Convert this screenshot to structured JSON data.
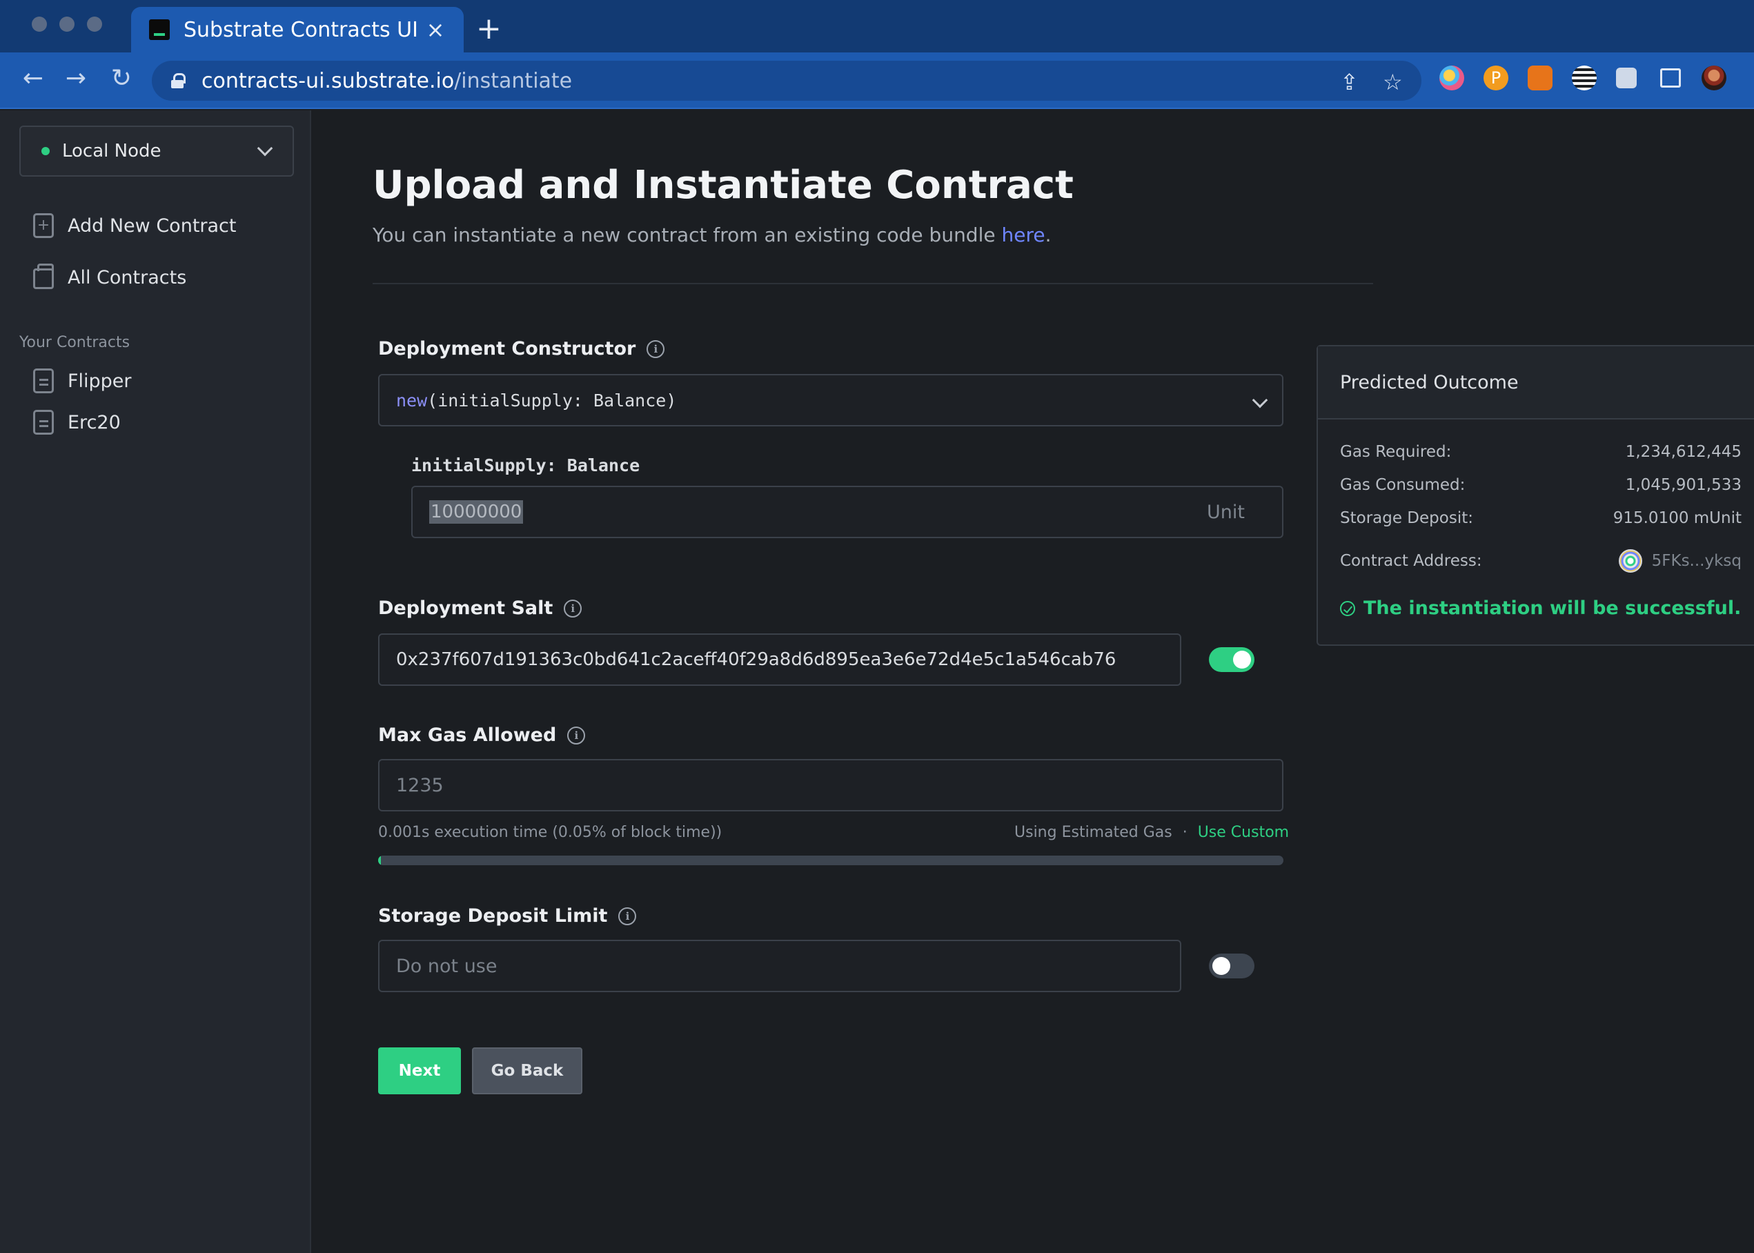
{
  "browser": {
    "tab_title": "Substrate Contracts UI",
    "tab_close": "×",
    "new_tab": "+",
    "url_host": "contracts-ui.substrate.io",
    "url_path": "/instantiate",
    "extensions": [
      "rainbow-ext-icon",
      "polkadot-ext-icon",
      "metamask-ext-icon",
      "talisman-ext-icon",
      "puzzle-icon",
      "sidepanel-icon",
      "profile-avatar"
    ]
  },
  "sidebar": {
    "node_label": "Local Node",
    "items": [
      {
        "label": "Add New Contract",
        "icon": "add-file-icon"
      },
      {
        "label": "All Contracts",
        "icon": "stack-icon"
      }
    ],
    "section_title": "Your Contracts",
    "contracts": [
      {
        "label": "Flipper",
        "icon": "document-icon"
      },
      {
        "label": "Erc20",
        "icon": "document-icon"
      }
    ]
  },
  "main": {
    "title": "Upload and Instantiate Contract",
    "subtitle_prefix": "You can instantiate a new contract from an existing code bundle ",
    "subtitle_link": "here",
    "subtitle_suffix": ".",
    "constructor": {
      "label": "Deployment Constructor",
      "keyword": "new",
      "signature": "(initialSupply: Balance)",
      "arg_label": "initialSupply: Balance",
      "arg_value": "10000000",
      "arg_unit": "Unit"
    },
    "salt": {
      "label": "Deployment Salt",
      "value": "0x237f607d191363c0bd641c2aceff40f29a8d6d895ea3e6e72d4e5c1a546cab76",
      "toggle_on": true
    },
    "gas": {
      "label": "Max Gas Allowed",
      "placeholder": "1235",
      "helper_left": "0.001s execution time (0.05% of block time))",
      "helper_right": "Using Estimated Gas",
      "helper_sep": "·",
      "helper_link": "Use Custom",
      "progress_fraction": 0.003
    },
    "storage": {
      "label": "Storage Deposit Limit",
      "placeholder": "Do not use",
      "toggle_on": false
    },
    "buttons": {
      "next": "Next",
      "back": "Go Back"
    }
  },
  "outcome": {
    "title": "Predicted Outcome",
    "rows": [
      {
        "key": "Gas Required:",
        "value": "1,234,612,445"
      },
      {
        "key": "Gas Consumed:",
        "value": "1,045,901,533"
      },
      {
        "key": "Storage Deposit:",
        "value": "915.0100 mUnit"
      },
      {
        "key": "Contract Address:",
        "value": "5FKs...yksq"
      }
    ],
    "success_text": "The instantiation will be successful."
  },
  "colors": {
    "accent_green": "#2ecf83",
    "link_blue": "#6f86ff",
    "browser_blue": "#1d5ab0"
  }
}
